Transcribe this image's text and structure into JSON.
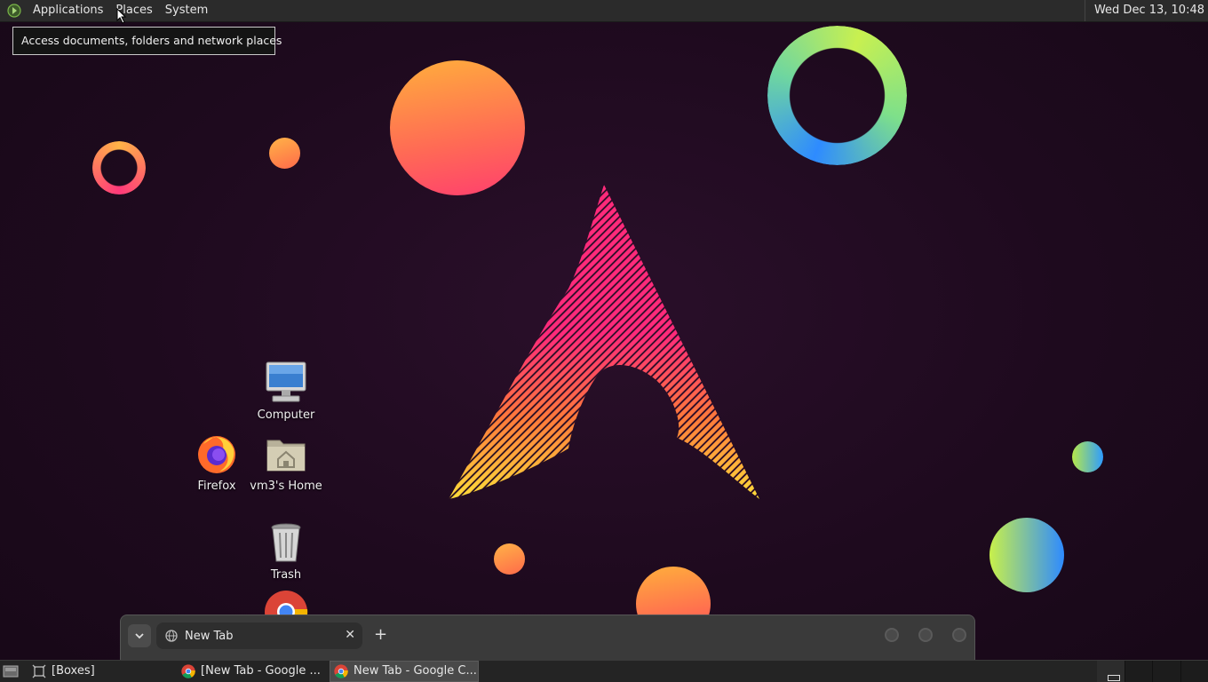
{
  "top_panel": {
    "menus": [
      "Applications",
      "Places",
      "System"
    ],
    "clock": "Wed Dec 13, 10:48"
  },
  "tooltip": {
    "text": "Access documents, folders and network places"
  },
  "desktop_icons": {
    "computer": "Computer",
    "firefox": "Firefox",
    "home": "vm3's Home",
    "trash": "Trash"
  },
  "browser": {
    "tab_title": "New Tab",
    "tab_close": "✕",
    "new_tab": "+"
  },
  "taskbar": {
    "tasks": [
      "[Boxes]",
      "[New Tab - Google ...",
      "New Tab - Google C..."
    ]
  },
  "colors": {
    "accent_pink": "#ff2a7a",
    "accent_orange": "#ff9a3c",
    "background": "#1e0a1e",
    "panel": "#2b2b2b"
  }
}
